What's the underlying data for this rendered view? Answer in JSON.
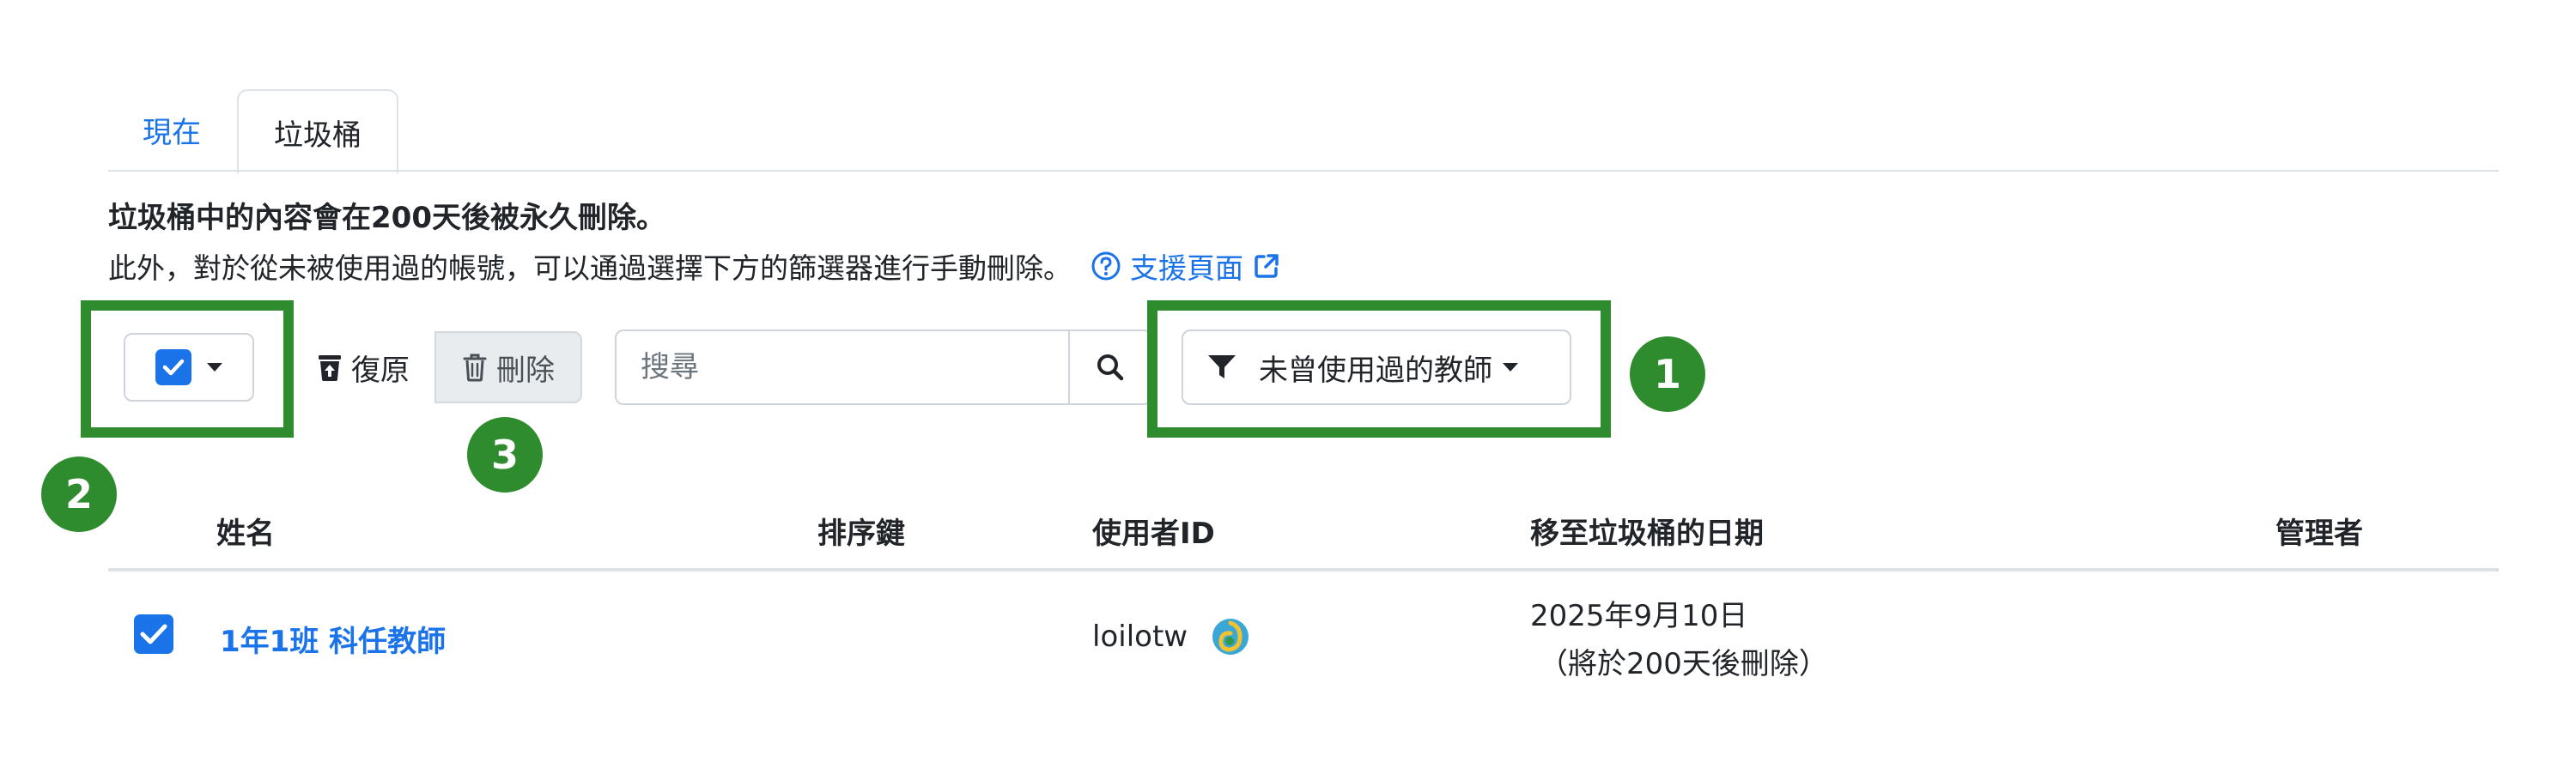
{
  "tabs": [
    {
      "label": "現在",
      "active": false
    },
    {
      "label": "垃圾桶",
      "active": true
    }
  ],
  "notice": "垃圾桶中的內容會在200天後被永久刪除。",
  "subnote": "此外，對於從未被使用過的帳號，可以通過選擇下方的篩選器進行手動刪除。",
  "support_link": "支援頁面",
  "toolbar": {
    "restore_label": "復原",
    "delete_label": "刪除",
    "search_placeholder": "搜尋",
    "filter_label": "未曾使用過的教師"
  },
  "annotations": [
    "1",
    "2",
    "3"
  ],
  "table": {
    "headers": [
      "姓名",
      "排序鍵",
      "使用者ID",
      "移至垃圾桶的日期",
      "管理者"
    ],
    "rows": [
      {
        "checked": true,
        "name": "1年1班 科任教師",
        "sort_key": "",
        "user_id": "loilotw",
        "date": "2025年9月10日",
        "date_note": "（將於200天後刪除）",
        "admin": ""
      }
    ]
  },
  "colors": {
    "accent": "#1a73e8",
    "annotation": "#2e8b2e"
  }
}
